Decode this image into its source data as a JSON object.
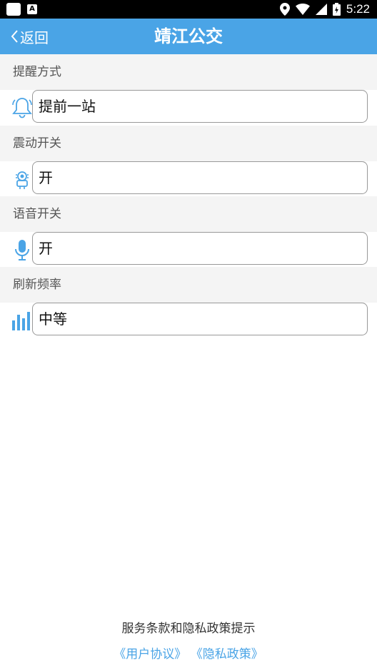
{
  "status_bar": {
    "time": "5:22",
    "notif_badge": "A"
  },
  "header": {
    "back_label": "返回",
    "title": "靖江公交"
  },
  "settings": [
    {
      "section": "提醒方式",
      "value": "提前一站",
      "icon": "bell-icon"
    },
    {
      "section": "震动开关",
      "value": "开",
      "icon": "vibration-icon"
    },
    {
      "section": "语音开关",
      "value": "开",
      "icon": "microphone-icon"
    },
    {
      "section": "刷新频率",
      "value": "中等",
      "icon": "bar-chart-icon"
    }
  ],
  "footer": {
    "note": "服务条款和隐私政策提示",
    "user_agreement": "《用户协议》",
    "privacy_policy": "《隐私政策》"
  },
  "colors": {
    "accent": "#4aa4e6",
    "section_bg": "#f4f4f4"
  }
}
